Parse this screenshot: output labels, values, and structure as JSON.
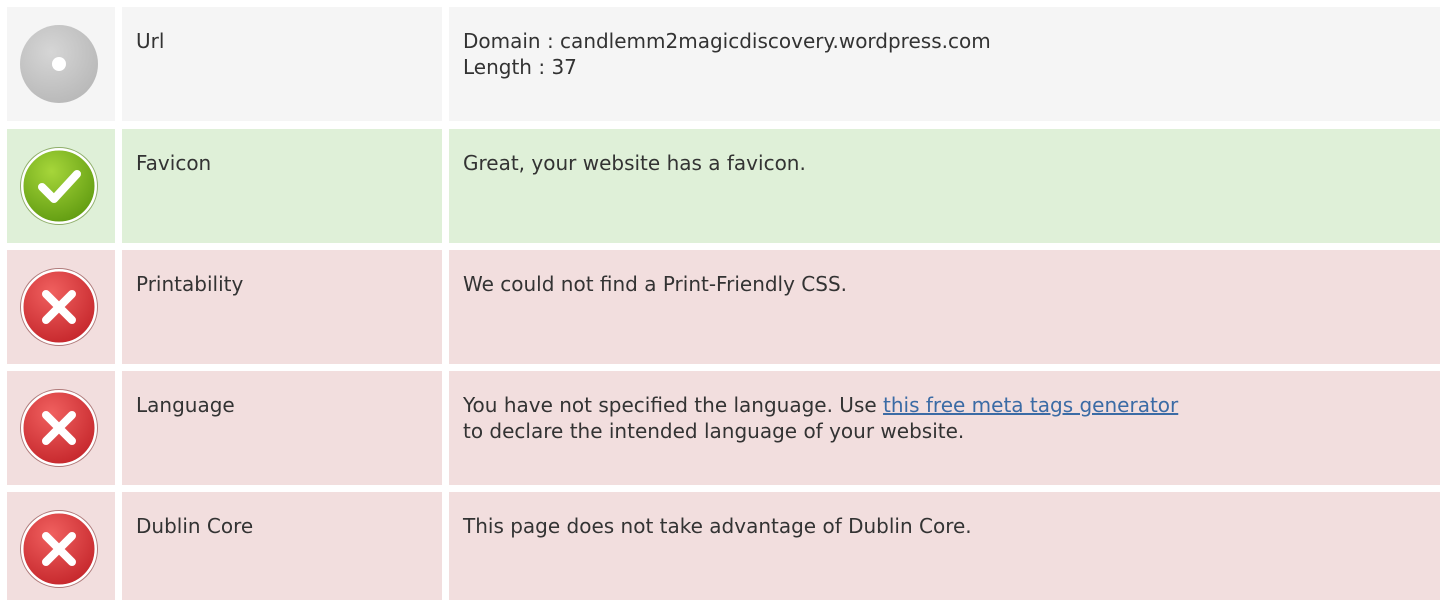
{
  "rows": [
    {
      "status": "neutral",
      "icon": "neutral-circle-icon",
      "label": "Url",
      "lines": [
        "Domain : candlemm2magicdiscovery.wordpress.com",
        "Length : 37"
      ]
    },
    {
      "status": "good",
      "icon": "check-circle-icon",
      "label": "Favicon",
      "text": "Great, your website has a favicon."
    },
    {
      "status": "bad",
      "icon": "error-x-icon",
      "label": "Printability",
      "text": "We could not find a Print-Friendly CSS."
    },
    {
      "status": "bad",
      "icon": "error-x-icon",
      "label": "Language",
      "text_before": "You have not specified the language. Use ",
      "link_text": "this free meta tags generator",
      "text_after": "to declare the intended language of your website."
    },
    {
      "status": "bad",
      "icon": "error-x-icon",
      "label": "Dublin Core",
      "text": "This page does not take advantage of Dublin Core."
    }
  ],
  "colors": {
    "neutral_bg": "#f5f5f5",
    "good_bg": "#dff0d8",
    "bad_bg": "#f2dede",
    "link": "#3b6ba5",
    "check_green": "#7ab317",
    "error_red": "#d9383a",
    "neutral_grey": "#c8c8c8"
  }
}
